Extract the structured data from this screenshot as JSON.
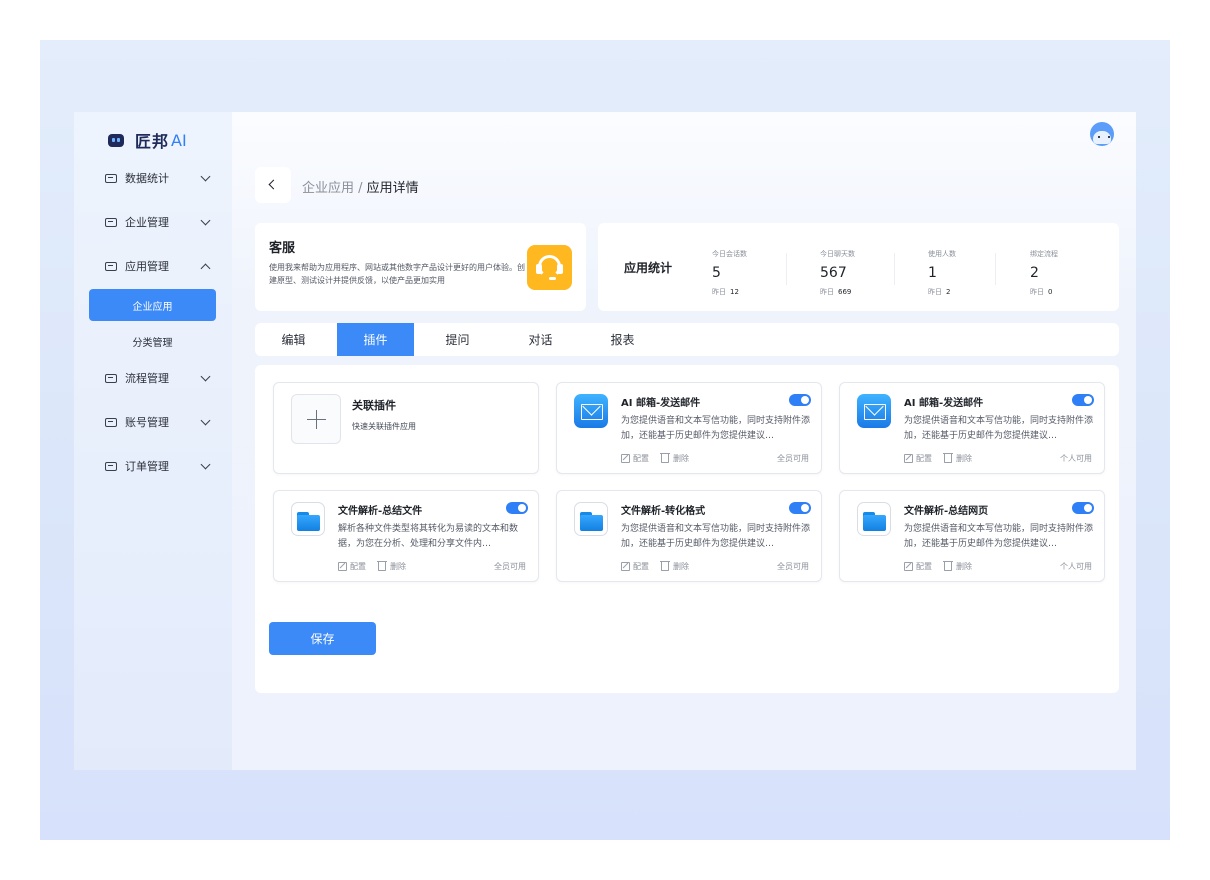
{
  "brand": {
    "name": "匠邦",
    "suffix": "AI"
  },
  "sidebar": {
    "items": [
      {
        "label": "数据统计"
      },
      {
        "label": "企业管理"
      },
      {
        "label": "应用管理"
      },
      {
        "label": "流程管理"
      },
      {
        "label": "账号管理"
      },
      {
        "label": "订单管理"
      }
    ],
    "sub_items": [
      {
        "label": "企业应用",
        "active": true
      },
      {
        "label": "分类管理",
        "active": false
      }
    ]
  },
  "breadcrumb": {
    "parent": "企业应用",
    "separator": " / ",
    "current": "应用详情"
  },
  "app": {
    "name": "客服",
    "description": "使用我来帮助为应用程序、网站或其他数字产品设计更好的用户体验。创建原型、测试设计并提供反馈，以使产品更加实用",
    "icon": "headset-icon",
    "icon_color": "#ffb820"
  },
  "stats": {
    "title": "应用统计",
    "items": [
      {
        "label": "今日会话数",
        "value": "5",
        "sub_label": "昨日",
        "sub_value": "12"
      },
      {
        "label": "今日聊天数",
        "value": "567",
        "sub_label": "昨日",
        "sub_value": "669"
      },
      {
        "label": "使用人数",
        "value": "1",
        "sub_label": "昨日",
        "sub_value": "2"
      },
      {
        "label": "绑定流程",
        "value": "2",
        "sub_label": "昨日",
        "sub_value": "0"
      }
    ]
  },
  "tabs": [
    {
      "label": "编辑",
      "active": false
    },
    {
      "label": "插件",
      "active": true
    },
    {
      "label": "提问",
      "active": false
    },
    {
      "label": "对话",
      "active": false
    },
    {
      "label": "报表",
      "active": false
    }
  ],
  "add_plugin": {
    "title": "关联插件",
    "description": "快速关联插件应用"
  },
  "plugins": [
    {
      "title": "AI 邮箱-发送邮件",
      "icon": "mail-icon",
      "description": "为您提供语音和文本写信功能，同时支持附件添加，还能基于历史邮件为您提供建议…",
      "edit": "配置",
      "delete": "删除",
      "scope": "全员可用",
      "enabled": true
    },
    {
      "title": "AI 邮箱-发送邮件",
      "icon": "mail-icon",
      "description": "为您提供语音和文本写信功能，同时支持附件添加，还能基于历史邮件为您提供建议…",
      "edit": "配置",
      "delete": "删除",
      "scope": "个人可用",
      "enabled": true
    },
    {
      "title": "文件解析-总结文件",
      "icon": "folder-icon",
      "description": "解析各种文件类型将其转化为易读的文本和数据，为您在分析、处理和分享文件内…",
      "edit": "配置",
      "delete": "删除",
      "scope": "全员可用",
      "enabled": true
    },
    {
      "title": "文件解析-转化格式",
      "icon": "folder-icon",
      "description": "为您提供语音和文本写信功能，同时支持附件添加，还能基于历史邮件为您提供建议…",
      "edit": "配置",
      "delete": "删除",
      "scope": "全员可用",
      "enabled": true
    },
    {
      "title": "文件解析-总结网页",
      "icon": "folder-icon",
      "description": "为您提供语音和文本写信功能，同时支持附件添加，还能基于历史邮件为您提供建议…",
      "edit": "配置",
      "delete": "删除",
      "scope": "个人可用",
      "enabled": true
    }
  ],
  "save_label": "保存",
  "colors": {
    "accent": "#3c8af7",
    "toggle_on": "#2f7ff6"
  }
}
